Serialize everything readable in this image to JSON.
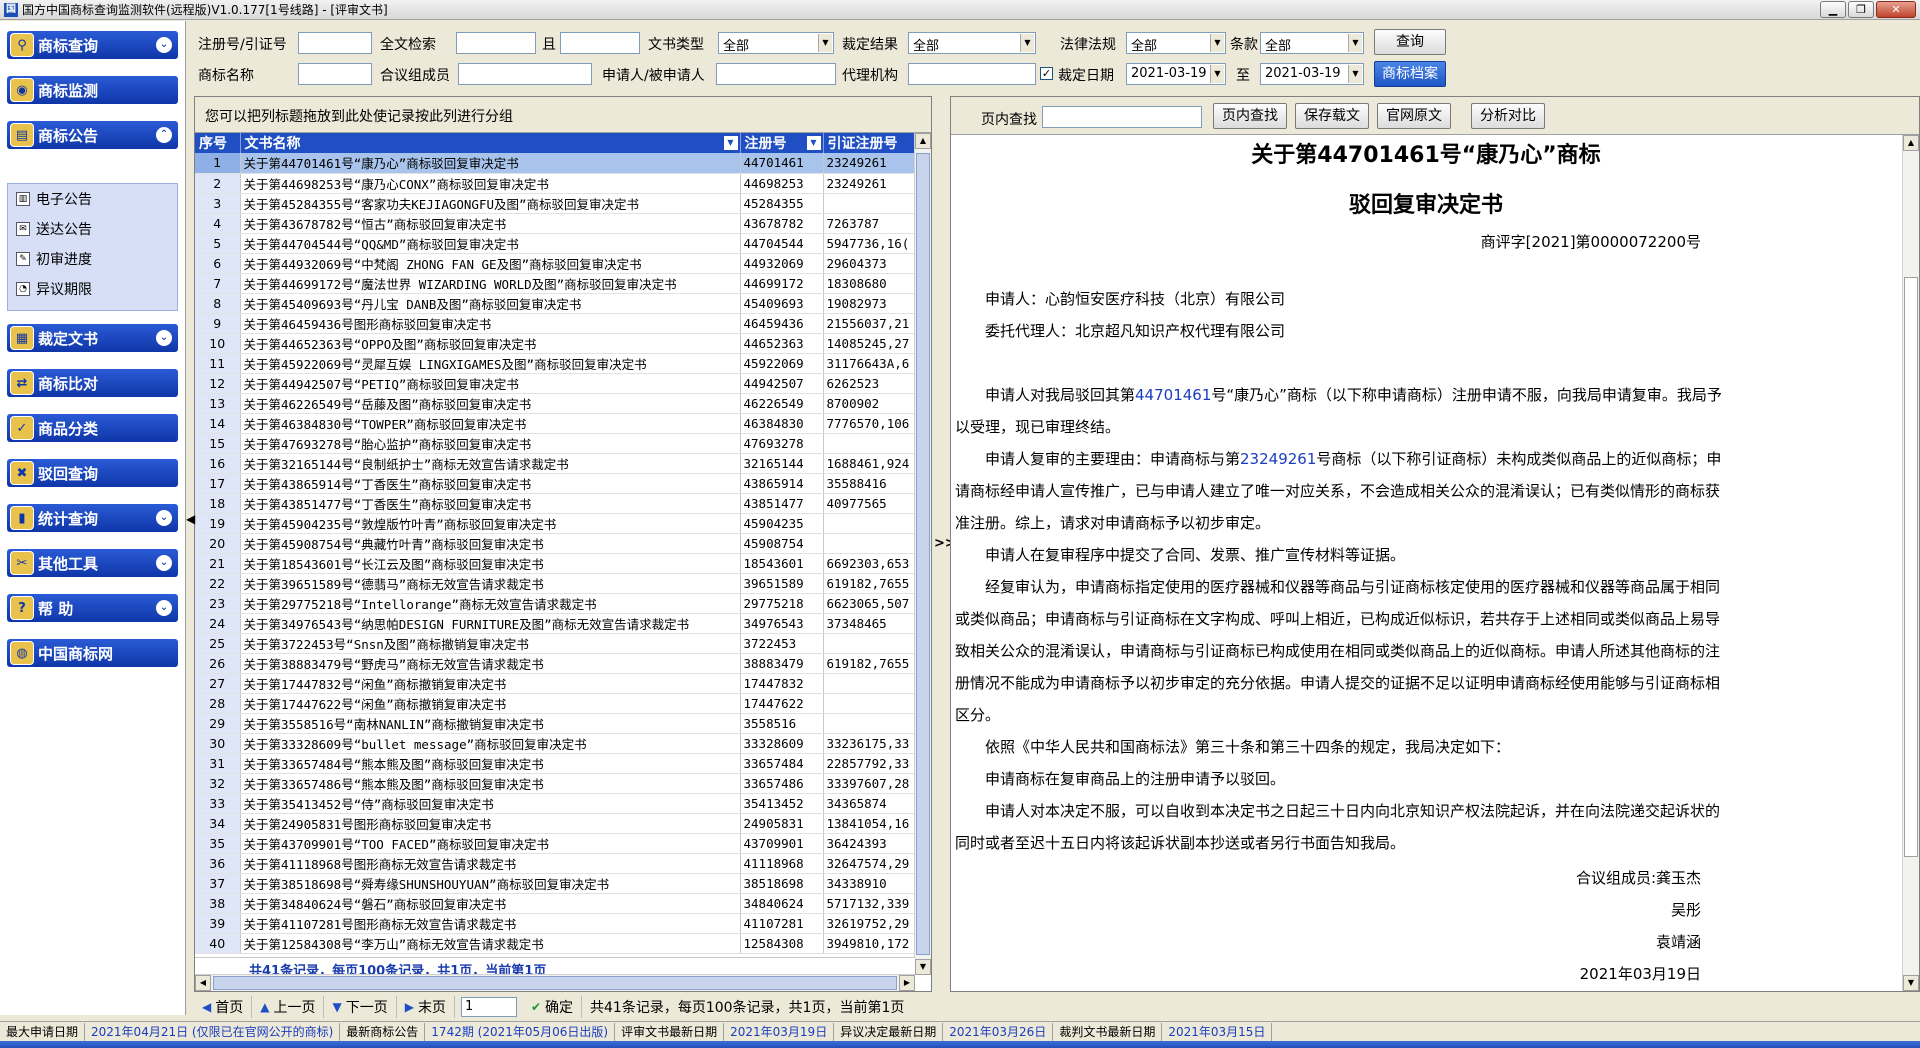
{
  "window": {
    "title": "国方中国商标查询监测软件(远程版)V1.0.177[1号线路] - [评审文书]",
    "icon": "app-icon",
    "buttons": [
      "minimize",
      "restore",
      "close"
    ]
  },
  "sidebar": {
    "sections": [
      {
        "label": "商标查询",
        "icon": "magnifier-icon"
      },
      {
        "label": "商标监测",
        "icon": "monitor-icon"
      },
      {
        "label": "商标公告",
        "icon": "announcement-icon"
      },
      {
        "label": "裁定文书",
        "icon": "document-icon"
      },
      {
        "label": "商标比对",
        "icon": "compare-icon"
      },
      {
        "label": "商品分类",
        "icon": "category-icon"
      },
      {
        "label": "驳回查询",
        "icon": "reject-icon"
      },
      {
        "label": "统计查询",
        "icon": "chart-icon"
      },
      {
        "label": "其他工具",
        "icon": "tools-icon"
      },
      {
        "label": "帮    助",
        "icon": "help-icon"
      },
      {
        "label": "中国商标网",
        "icon": "globe-icon"
      }
    ],
    "sub_items": [
      {
        "label": "电子公告",
        "icon": "notebook-icon"
      },
      {
        "label": "送达公告",
        "icon": "delivery-icon"
      },
      {
        "label": "初审进度",
        "icon": "progress-icon"
      },
      {
        "label": "异议期限",
        "icon": "deadline-icon"
      }
    ]
  },
  "filters": {
    "reg_no_label": "注册号/引证号",
    "fulltext_label": "全文检索",
    "and_label": "且",
    "doc_type_label": "文书类型",
    "doc_type_value": "全部",
    "result_label": "裁定结果",
    "result_value": "全部",
    "law_label": "法律法规",
    "law_value": "全部",
    "article_label": "条款",
    "article_value": "全部",
    "search_btn": "查询",
    "tm_name_label": "商标名称",
    "panel_label": "合议组成员",
    "applicant_label": "申请人/被申请人",
    "agent_label": "代理机构",
    "date_label": "裁定日期",
    "date_from": "2021-03-19",
    "to_label": "至",
    "date_to": "2021-03-19",
    "archive_btn": "商标档案"
  },
  "table": {
    "group_hint": "您可以把列标题拖放到此处使记录按此列进行分组",
    "headers": [
      "序号",
      "文书名称",
      "注册号",
      "引证注册号"
    ],
    "rows": [
      [
        "1",
        "关于第44701461号“康乃心”商标驳回复审决定书",
        "44701461",
        "23249261"
      ],
      [
        "2",
        "关于第44698253号“康乃心CONX”商标驳回复审决定书",
        "44698253",
        "23249261"
      ],
      [
        "3",
        "关于第45284355号“客家功夫KEJIAGONGFU及图”商标驳回复审决定书",
        "45284355",
        ""
      ],
      [
        "4",
        "关于第43678782号“恒古”商标驳回复审决定书",
        "43678782",
        "7263787"
      ],
      [
        "5",
        "关于第44704544号“QQ&MD”商标驳回复审决定书",
        "44704544",
        "5947736,16("
      ],
      [
        "6",
        "关于第44932069号“中梵阁 ZHONG FAN GE及图”商标驳回复审决定书",
        "44932069",
        "29604373"
      ],
      [
        "7",
        "关于第44699172号“魔法世界 WIZARDING WORLD及图”商标驳回复审决定书",
        "44699172",
        "18308680"
      ],
      [
        "8",
        "关于第45409693号“丹儿宝 DANB及图”商标驳回复审决定书",
        "45409693",
        "19082973"
      ],
      [
        "9",
        "关于第46459436号图形商标驳回复审决定书",
        "46459436",
        "21556037,21"
      ],
      [
        "10",
        "关于第44652363号“OPPO及图”商标驳回复审决定书",
        "44652363",
        "14085245,27"
      ],
      [
        "11",
        "关于第45922069号“灵犀互娱 LINGXIGAMES及图”商标驳回复审决定书",
        "45922069",
        "31176643A,6"
      ],
      [
        "12",
        "关于第44942507号“PETIQ”商标驳回复审决定书",
        "44942507",
        "6262523"
      ],
      [
        "13",
        "关于第46226549号“岳藤及图”商标驳回复审决定书",
        "46226549",
        "8700902"
      ],
      [
        "14",
        "关于第46384830号“TOWPER”商标驳回复审决定书",
        "46384830",
        "7776570,106"
      ],
      [
        "15",
        "关于第47693278号“胎心监护”商标驳回复审决定书",
        "47693278",
        ""
      ],
      [
        "16",
        "关于第32165144号“良制纸护士”商标无效宣告请求裁定书",
        "32165144",
        "1688461,924"
      ],
      [
        "17",
        "关于第43865914号“丁香医生”商标驳回复审决定书",
        "43865914",
        "35588416"
      ],
      [
        "18",
        "关于第43851477号“丁香医生”商标驳回复审决定书",
        "43851477",
        "40977565"
      ],
      [
        "19",
        "关于第45904235号“敦煌版竹叶青”商标驳回复审决定书",
        "45904235",
        ""
      ],
      [
        "20",
        "关于第45908754号“典藏竹叶青”商标驳回复审决定书",
        "45908754",
        ""
      ],
      [
        "21",
        "关于第18543601号“长江云及图”商标驳回复审决定书",
        "18543601",
        "6692303,653"
      ],
      [
        "22",
        "关于第39651589号“德翡马”商标无效宣告请求裁定书",
        "39651589",
        "619182,7655"
      ],
      [
        "23",
        "关于第29775218号“Intellorange”商标无效宣告请求裁定书",
        "29775218",
        "6623065,507"
      ],
      [
        "24",
        "关于第34976543号“纳思帕DESIGN FURNITURE及图”商标无效宣告请求裁定书",
        "34976543",
        "37348465"
      ],
      [
        "25",
        "关于第3722453号“Snsn及图”商标撤销复审决定书",
        "3722453",
        ""
      ],
      [
        "26",
        "关于第38883479号“野虎马”商标无效宣告请求裁定书",
        "38883479",
        "619182,7655"
      ],
      [
        "27",
        "关于第17447832号“闲鱼”商标撤销复审决定书",
        "17447832",
        ""
      ],
      [
        "28",
        "关于第17447622号“闲鱼”商标撤销复审决定书",
        "17447622",
        ""
      ],
      [
        "29",
        "关于第3558516号“南林NANLIN”商标撤销复审决定书",
        "3558516",
        ""
      ],
      [
        "30",
        "关于第33328609号“bullet message”商标驳回复审决定书",
        "33328609",
        "33236175,33"
      ],
      [
        "31",
        "关于第33657484号“熊本熊及图”商标驳回复审决定书",
        "33657484",
        "22857792,33"
      ],
      [
        "32",
        "关于第33657486号“熊本熊及图”商标驳回复审决定书",
        "33657486",
        "33397607,28"
      ],
      [
        "33",
        "关于第35413452号“侍”商标驳回复审决定书",
        "35413452",
        "34365874"
      ],
      [
        "34",
        "关于第24905831号图形商标驳回复审决定书",
        "24905831",
        "13841054,16"
      ],
      [
        "35",
        "关于第43709901号“TOO FACED”商标驳回复审决定书",
        "43709901",
        "36424393"
      ],
      [
        "36",
        "关于第41118968号图形商标无效宣告请求裁定书",
        "41118968",
        "32647574,29"
      ],
      [
        "37",
        "关于第38518698号“舜寿缘SHUNSHOUYUAN”商标驳回复审决定书",
        "38518698",
        "34338910"
      ],
      [
        "38",
        "关于第34840624号“磐石”商标驳回复审决定书",
        "34840624",
        "5717132,339"
      ],
      [
        "39",
        "关于第41107281号图形商标无效宣告请求裁定书",
        "41107281",
        "32619752,29"
      ],
      [
        "40",
        "关于第12584308号“李万山”商标无效宣告请求裁定书",
        "12584308",
        "3949810,172"
      ]
    ],
    "summary": "共41条记录，每页100条记录，共1页，当前第1页"
  },
  "doc_toolbar": {
    "find_label": "页内查找",
    "find_btn": "页内查找",
    "save_btn": "保存载文",
    "official_btn": "官网原文",
    "analysis_btn": "分析对比"
  },
  "document": {
    "title1": "关于第44701461号“康乃心”商标",
    "title2": "驳回复审决定书",
    "case_no": "商评字[2021]第0000072200号",
    "applicant": "申请人：心韵恒安医疗科技（北京）有限公司",
    "agent": "委托代理人：北京超凡知识产权代理有限公司",
    "p1_a": "申请人对我局驳回其第",
    "p1_hl": "44701461",
    "p1_b": "号“康乃心”商标（以下称申请商标）注册申请不服，向我局申请复审。我局予以受理，现已审理终结。",
    "p2_a": "申请人复审的主要理由：申请商标与第",
    "p2_hl": "23249261",
    "p2_b": "号商标（以下称引证商标）未构成类似商品上的近似商标；申请商标经申请人宣传推广，已与申请人建立了唯一对应关系，不会造成相关公众的混淆误认；已有类似情形的商标获准注册。综上，请求对申请商标予以初步审定。",
    "p3": "申请人在复审程序中提交了合同、发票、推广宣传材料等证据。",
    "p4": "经复审认为，申请商标指定使用的医疗器械和仪器等商品与引证商标核定使用的医疗器械和仪器等商品属于相同或类似商品；申请商标与引证商标在文字构成、呼叫上相近，已构成近似标识，若共存于上述相同或类似商品上易导致相关公众的混淆误认，申请商标与引证商标已构成使用在相同或类似商品上的近似商标。申请人所述其他商标的注册情况不能成为申请商标予以初步审定的充分依据。申请人提交的证据不足以证明申请商标经使用能够与引证商标相区分。",
    "p5": "依照《中华人民共和国商标法》第三十条和第三十四条的规定，我局决定如下：",
    "p6": "申请商标在复审商品上的注册申请予以驳回。",
    "p7": "申请人对本决定不服，可以自收到本决定书之日起三十日内向北京知识产权法院起诉，并在向法院递交起诉状的同时或者至迟十五日内将该起诉状副本抄送或者另行书面告知我局。",
    "sign1": "合议组成员:龚玉杰",
    "sign2": "吴彤",
    "sign3": "袁靖涵",
    "date": "2021年03月19日"
  },
  "pager": {
    "first": "首页",
    "prev": "上一页",
    "next": "下一页",
    "last": "末页",
    "page_input": "1",
    "confirm": "确定",
    "summary": "共41条记录，每页100条记录，共1页，当前第1页"
  },
  "status": {
    "s1_label": "最大申请日期",
    "s1_value": "2021年04月21日 (仅限已在官网公开的商标)",
    "s2_label": "最新商标公告",
    "s2_value": "1742期 (2021年05月06日出版)",
    "s3_label": "评审文书最新日期",
    "s3_value": "2021年03月19日",
    "s4_label": "异议决定最新日期",
    "s4_value": "2021年03月26日",
    "s5_label": "裁判文书最新日期",
    "s5_value": "2021年03月15日"
  },
  "colors": {
    "accent": "#1f4fc2",
    "selected_row": "#a9c4ec",
    "link_blue": "#1a3cc0"
  }
}
